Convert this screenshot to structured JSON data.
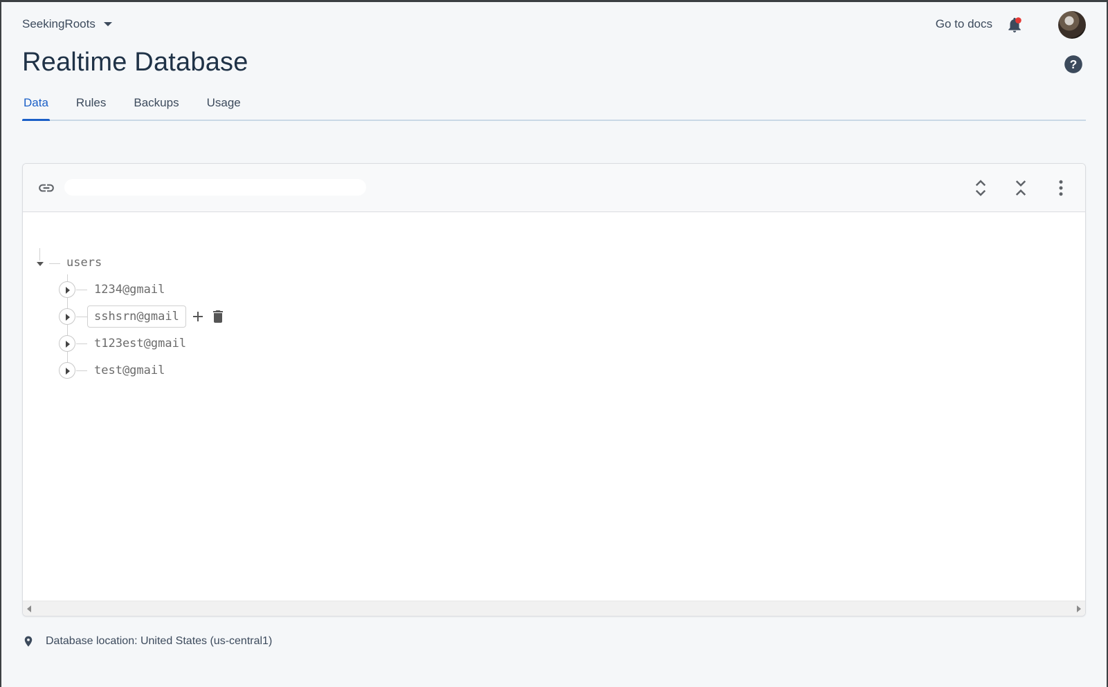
{
  "header": {
    "project_name": "SeekingRoots",
    "go_to_docs": "Go to docs",
    "title": "Realtime Database"
  },
  "tabs": [
    {
      "label": "Data",
      "active": true
    },
    {
      "label": "Rules",
      "active": false
    },
    {
      "label": "Backups",
      "active": false
    },
    {
      "label": "Usage",
      "active": false
    }
  ],
  "panel": {
    "url_value": ""
  },
  "tree": {
    "root_key": "users",
    "children": [
      {
        "key": "1234@gmail"
      },
      {
        "key": "sshsrn@gmail",
        "hovered": true
      },
      {
        "key": "t123est@gmail"
      },
      {
        "key": "test@gmail"
      }
    ]
  },
  "footer": {
    "location_text": "Database location: United States (us-central1)"
  },
  "colors": {
    "accent": "#1a5fc7",
    "title": "#1f3247",
    "notification_dot": "#e53935"
  },
  "icons": {
    "bell": "bell-icon",
    "help": "help-icon",
    "link": "link-icon",
    "expand_all": "expand-all-icon",
    "collapse_all": "collapse-all-icon",
    "more": "more-vert-icon",
    "add": "add-icon",
    "delete": "delete-icon",
    "pin": "location-pin-icon"
  }
}
